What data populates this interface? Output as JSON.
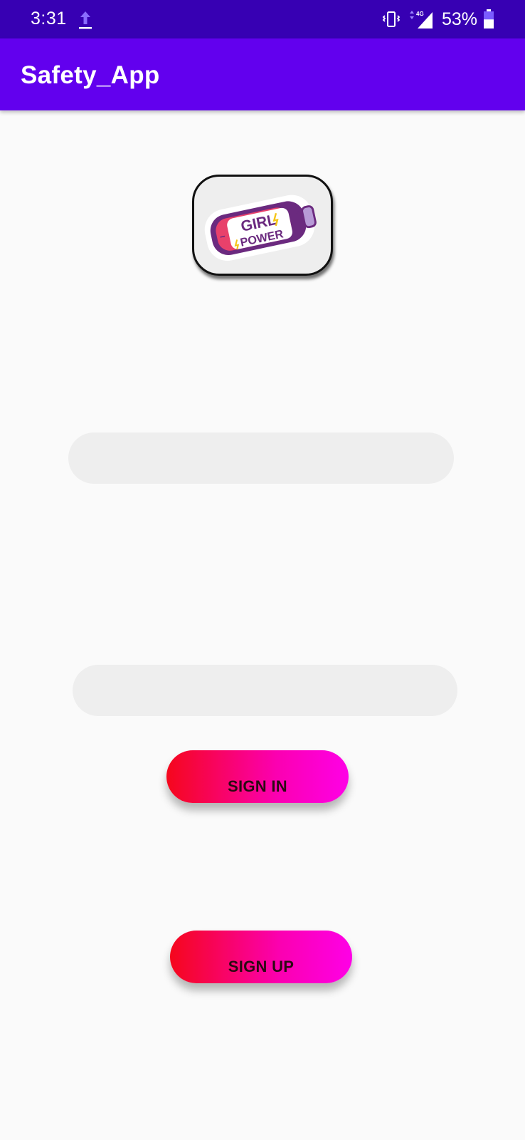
{
  "status_bar": {
    "time": "3:31",
    "battery_percent": "53%",
    "network": "4G",
    "icons": [
      "upload-icon",
      "vibrate-icon",
      "signal-icon",
      "battery-icon"
    ],
    "battery_level": 0.53
  },
  "app_bar": {
    "title": "Safety_App"
  },
  "logo": {
    "text_line1": "GIRL",
    "text_line2": "POWER",
    "plus_sign": "+",
    "minus_sign": "−"
  },
  "form": {
    "field1": {
      "value": "",
      "placeholder": ""
    },
    "field2": {
      "value": "",
      "placeholder": ""
    }
  },
  "buttons": {
    "sign_in": "SIGN IN",
    "sign_up": "SIGN UP"
  },
  "colors": {
    "status_bar": "#3700b3",
    "app_bar": "#6200ee",
    "background": "#fafafa",
    "button_gradient_start": "#f5071c",
    "button_gradient_end": "#fe00e6"
  }
}
